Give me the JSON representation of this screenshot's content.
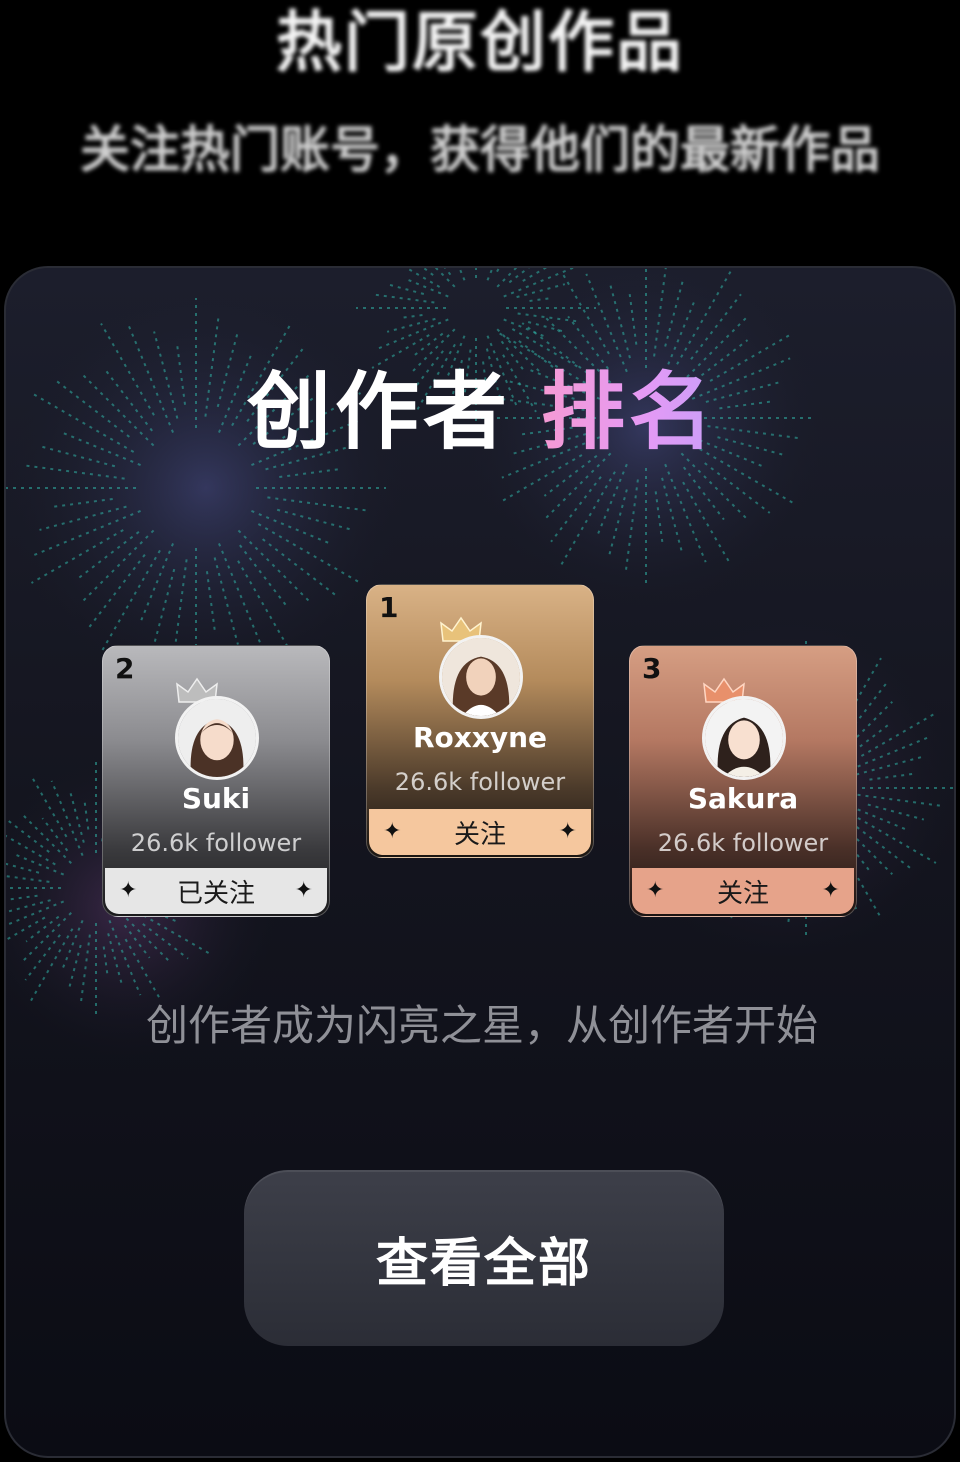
{
  "header": {
    "title": "热门原创作品",
    "subtitle": "关注热门账号，获得他们的最新作品"
  },
  "panel": {
    "title_main": "创作者",
    "title_accent": "排名",
    "slogan": "创作者成为闪亮之星，从创作者开始",
    "view_all_label": "查看全部"
  },
  "creators": [
    {
      "rank": "2",
      "name": "Suki",
      "followers": "26.6k follower",
      "button_label": "已关注",
      "tier": "silver"
    },
    {
      "rank": "1",
      "name": "Roxxyne",
      "followers": "26.6k follower",
      "button_label": "关注",
      "tier": "gold"
    },
    {
      "rank": "3",
      "name": "Sakura",
      "followers": "26.6k follower",
      "button_label": "关注",
      "tier": "bronze"
    }
  ],
  "icons": {
    "sparkle": "✦",
    "crown": "crown-icon"
  },
  "colors": {
    "title_accent_gradient": [
      "#f59ad4",
      "#c99ef8"
    ],
    "silver": "#b9b9bc",
    "gold": "#d9b286",
    "bronze": "#d69e83"
  }
}
